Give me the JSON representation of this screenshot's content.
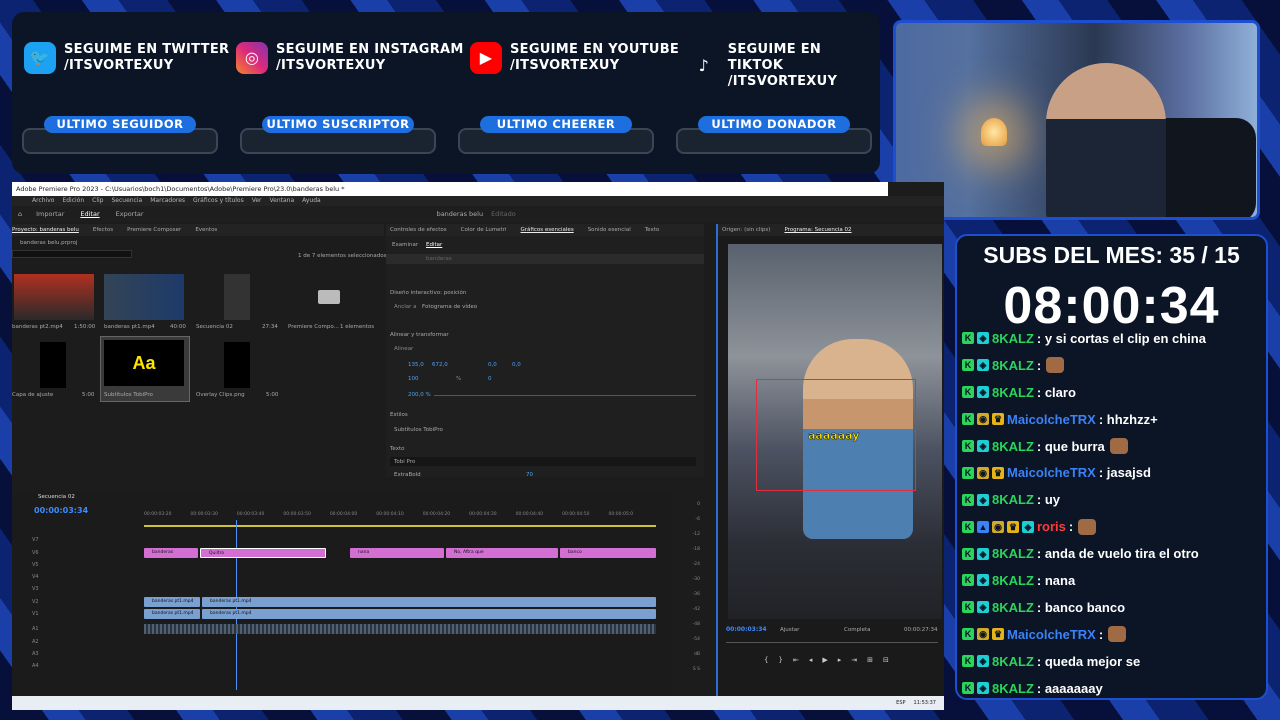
{
  "social": [
    {
      "label": "SEGUIME EN TWITTER",
      "handle": "/ITSVORTEXUY",
      "icon": "twitter-icon",
      "color": "#1da1f2",
      "glyph": "t"
    },
    {
      "label": "SEGUIME EN INSTAGRAM",
      "handle": "/ITSVORTEXUY",
      "icon": "instagram-icon",
      "color": "#d6249f",
      "glyph": "◎"
    },
    {
      "label": "SEGUIME EN YOUTUBE",
      "handle": "/ITSVORTEXUY",
      "icon": "youtube-icon",
      "color": "#ff0000",
      "glyph": "▶"
    },
    {
      "label": "SEGUIME EN TIKTOK",
      "handle": "/ITSVORTEXUY",
      "icon": "tiktok-icon",
      "color": "#111111",
      "glyph": "♪"
    }
  ],
  "slots": [
    "ULTIMO SEGUIDOR",
    "ULTIMO SUSCRIPTOR",
    "ULTIMO CHEERER",
    "ULTIMO DONADOR"
  ],
  "subs": {
    "title": "SUBS DEL MES: 35 / 15",
    "timer": "08:00:34"
  },
  "chat": [
    {
      "user": "8KALZ",
      "color": "#2bd45b",
      "badges": [
        "k",
        "g"
      ],
      "text": ": y si cortas el clip en china"
    },
    {
      "user": "8KALZ",
      "color": "#2bd45b",
      "badges": [
        "k",
        "g"
      ],
      "text": ":",
      "emote": true
    },
    {
      "user": "8KALZ",
      "color": "#2bd45b",
      "badges": [
        "k",
        "g"
      ],
      "text": ": claro"
    },
    {
      "user": "MaicolcheTRX",
      "color": "#3b82f6",
      "badges": [
        "k",
        "s",
        "c"
      ],
      "text": ": hhzhzz+"
    },
    {
      "user": "8KALZ",
      "color": "#2bd45b",
      "badges": [
        "k",
        "g"
      ],
      "text": ": que burra",
      "emote": true
    },
    {
      "user": "MaicolcheTRX",
      "color": "#3b82f6",
      "badges": [
        "k",
        "s",
        "c"
      ],
      "text": ": jasajsd"
    },
    {
      "user": "8KALZ",
      "color": "#2bd45b",
      "badges": [
        "k",
        "g"
      ],
      "text": ": uy"
    },
    {
      "user": "roris",
      "color": "#ff3b3b",
      "badges": [
        "k",
        "p",
        "s",
        "c",
        "g"
      ],
      "text": ":",
      "emote": true
    },
    {
      "user": "8KALZ",
      "color": "#2bd45b",
      "badges": [
        "k",
        "g"
      ],
      "text": ": anda de vuelo tira el otro"
    },
    {
      "user": "8KALZ",
      "color": "#2bd45b",
      "badges": [
        "k",
        "g"
      ],
      "text": ": nana"
    },
    {
      "user": "8KALZ",
      "color": "#2bd45b",
      "badges": [
        "k",
        "g"
      ],
      "text": ": banco banco"
    },
    {
      "user": "MaicolcheTRX",
      "color": "#3b82f6",
      "badges": [
        "k",
        "s",
        "c"
      ],
      "text": ":",
      "emote": true
    },
    {
      "user": "8KALZ",
      "color": "#2bd45b",
      "badges": [
        "k",
        "g"
      ],
      "text": ": queda mejor se"
    },
    {
      "user": "8KALZ",
      "color": "#2bd45b",
      "badges": [
        "k",
        "g"
      ],
      "text": ": aaaaaaay"
    }
  ],
  "premiere": {
    "title": "Adobe Premiere Pro 2023 - C:\\Usuarios\\boch1\\Documentos\\Adobe\\Premiere Pro\\23.0\\banderas belu *",
    "menu": [
      "Archivo",
      "Edición",
      "Clip",
      "Secuencia",
      "Marcadores",
      "Gráficos y títulos",
      "Ver",
      "Ventana",
      "Ayuda"
    ],
    "workspaces": [
      "Importar",
      "Editar",
      "Exportar"
    ],
    "project_name": "banderas belu",
    "edited": "Editado",
    "project_tabs": [
      "Proyecto: banderas belu",
      "Efectos",
      "Premiere Composer",
      "Eventos"
    ],
    "project_file": "banderas belu.prproj",
    "project_count": "1 de 7 elementos seleccionados",
    "items": [
      {
        "name": "banderas pt2.mp4",
        "dur": "1:50:00"
      },
      {
        "name": "banderas pt1.mp4",
        "dur": "40:00"
      },
      {
        "name": "Secuencia 02",
        "dur": "27:34"
      },
      {
        "name": "Premiere Compo...",
        "dur": "1 elementos"
      },
      {
        "name": "Capa de ajuste",
        "dur": "5:00"
      },
      {
        "name": "Subtítulos TobiPro",
        "dur": ""
      },
      {
        "name": "Overlay Clips.png",
        "dur": "5:00"
      }
    ],
    "subtitle_thumb": "Aa",
    "eg_tabs": [
      "Controles de efectos",
      "Color de Lumetri",
      "Gráficos esenciales",
      "Sonido esencial",
      "Texto"
    ],
    "eg_sub": [
      "Examinar",
      "Editar"
    ],
    "eg_layer": "banderas",
    "eg_design": "Diseño interactivo: posición",
    "eg_anchor": "Anclar a",
    "eg_anchor_val": "Fotograma de vídeo",
    "eg_align": "Alinear y transformar",
    "eg_align_lbl": "Alinear",
    "eg_pos": [
      "135,0",
      "672,0"
    ],
    "eg_rot": "0,0",
    "eg_rot2": "0,0",
    "eg_scale": "100",
    "eg_pct": "%",
    "eg_opacity": "0",
    "eg_zoom": "200,0 %",
    "eg_styles": "Estilos",
    "eg_style_val": "Subtítulos TobiPro",
    "eg_text": "Texto",
    "eg_font": "Tobi Pro",
    "eg_weight": "ExtraBold",
    "eg_size": "70",
    "prog_tabs": [
      "Origen: (sin clips)",
      "Programa: Secuencia 02"
    ],
    "caption": "aaaaaay",
    "prog_tc": "00:00:03:34",
    "prog_fit": "Ajustar",
    "prog_quality": "Completa",
    "prog_dur": "00:00:27:34",
    "seq_name": "Secuencia 02",
    "seq_tc": "00:00:03:34",
    "ruler": [
      "00:00:03:20",
      "00:00:03:30",
      "00:00:03:40",
      "00:00:03:50",
      "00:00:04:00",
      "00:00:04:10",
      "00:00:04:20",
      "00:00:04:30",
      "00:00:04:40",
      "00:00:04:50",
      "00:00:05:0"
    ],
    "tracks": [
      "V7",
      "V6",
      "V5",
      "V4",
      "V3",
      "V2",
      "V1",
      "A1",
      "A2",
      "A3",
      "A4"
    ],
    "v6_clips": [
      "banderas",
      "Quiltro",
      "nana",
      "No, Aftra que",
      "banco"
    ],
    "v1_clips": [
      "banderas pt1.mp4",
      "banderas pt1.mp4"
    ],
    "v1b_clips": [
      "banderas pt1.mp4",
      "banderas pt1.mp4"
    ],
    "meter": [
      "0",
      "-6",
      "-12",
      "-18",
      "-24",
      "-30",
      "-36",
      "-42",
      "-48",
      "-54",
      "dB"
    ],
    "meter_ss": "S S",
    "tray": [
      "ESP",
      "11:53:37"
    ]
  }
}
